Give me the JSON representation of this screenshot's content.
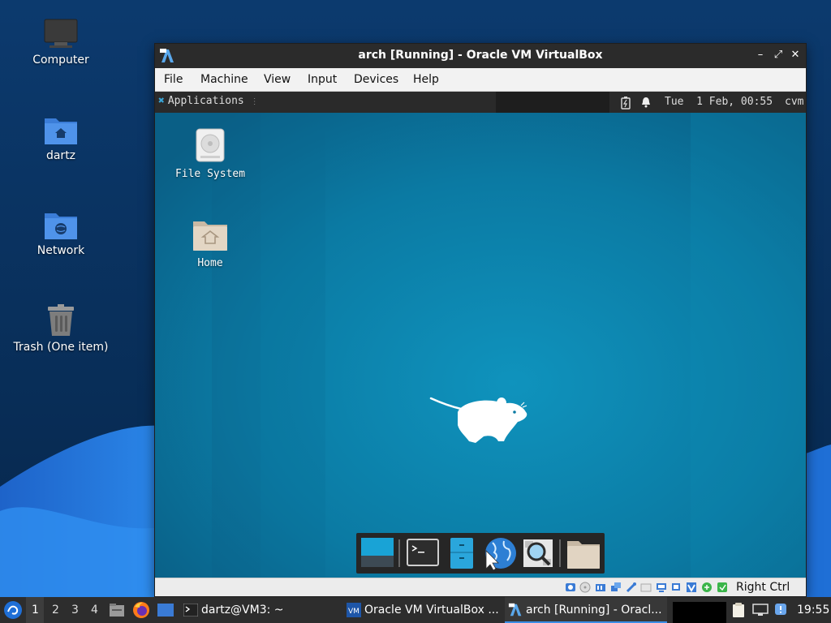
{
  "host_desktop": {
    "icons": [
      {
        "label": "Computer",
        "icon": "computer-icon"
      },
      {
        "label": "dartz",
        "icon": "home-folder-icon"
      },
      {
        "label": "Network",
        "icon": "network-folder-icon"
      },
      {
        "label": "Trash (One item)",
        "icon": "trash-icon"
      }
    ]
  },
  "vbox_window": {
    "title": "arch [Running] - Oracle VM VirtualBox",
    "menu": [
      "File",
      "Machine",
      "View",
      "Input",
      "Devices",
      "Help"
    ],
    "controls": {
      "minimize": "–",
      "maximize": "⤢",
      "close": "✕"
    },
    "host_key": "Right Ctrl"
  },
  "guest": {
    "panel": {
      "applications": "Applications",
      "clock": "Tue  1 Feb, 00:55",
      "user": "cvm"
    },
    "desktop_icons": [
      {
        "label": "File System",
        "icon": "drive-icon"
      },
      {
        "label": "Home",
        "icon": "home-folder-icon"
      }
    ],
    "dock_items": [
      "show-desktop",
      "terminal",
      "file-manager",
      "web-browser",
      "app-finder",
      "folder"
    ]
  },
  "taskbar": {
    "workspaces": [
      "1",
      "2",
      "3",
      "4"
    ],
    "active_workspace": "1",
    "tasks": [
      {
        "label": "dartz@VM3: ~",
        "icon": "terminal-icon"
      },
      {
        "label": "Oracle VM VirtualBox ...",
        "icon": "virtualbox-icon"
      },
      {
        "label": "arch [Running] - Oracl...",
        "icon": "virtualbox-icon",
        "active": true
      }
    ],
    "clock": "19:55"
  },
  "colors": {
    "host_bg_top": "#0a2f5a",
    "host_wave": "#1f6fd6",
    "guest_bg": "#0d7fa6",
    "taskbar": "#2d2d2d"
  }
}
